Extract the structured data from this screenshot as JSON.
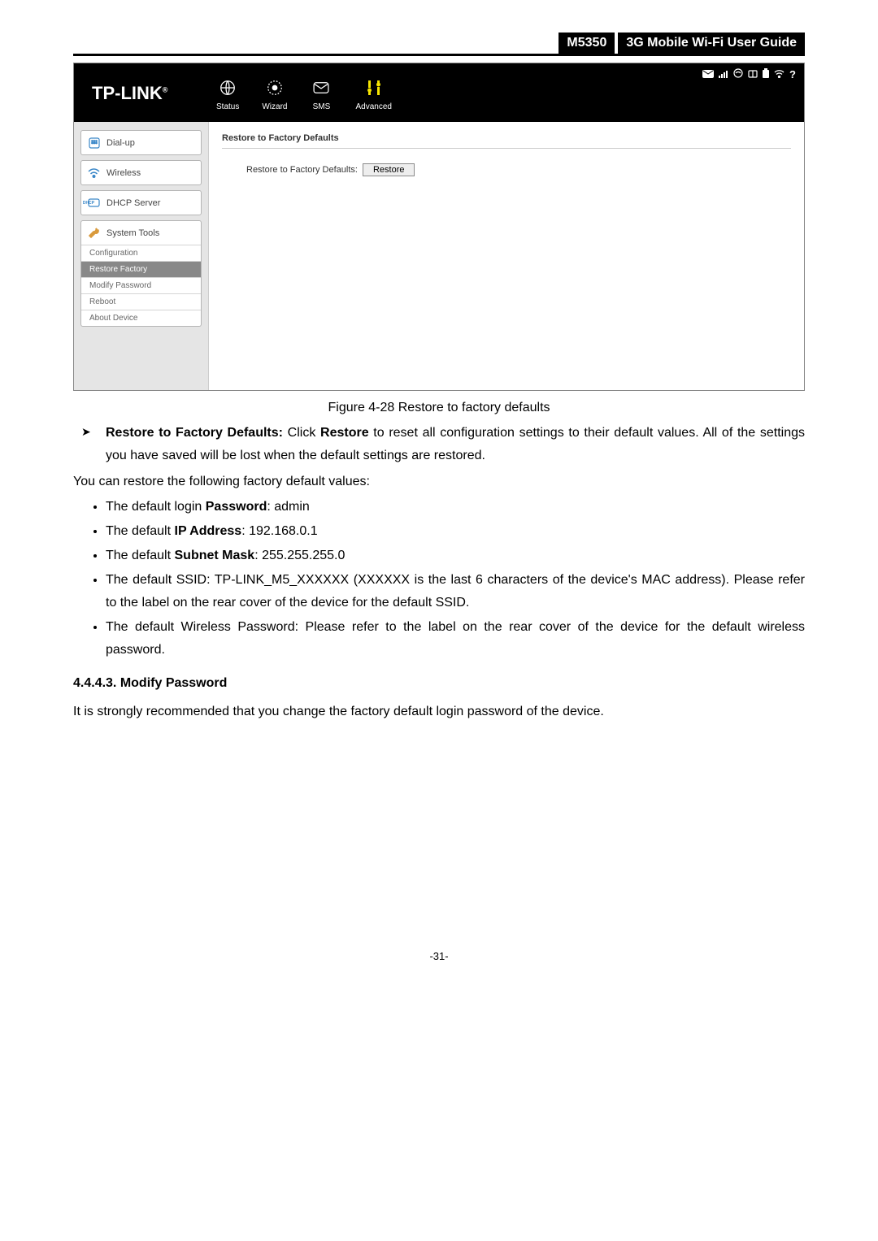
{
  "header": {
    "model": "M5350",
    "title": "3G Mobile Wi-Fi User Guide"
  },
  "app": {
    "logo": "TP-LINK",
    "topnav": {
      "status": "Status",
      "wizard": "Wizard",
      "sms": "SMS",
      "advanced": "Advanced"
    },
    "sidebar": {
      "dialup": "Dial-up",
      "wireless": "Wireless",
      "dhcp": "DHCP Server",
      "system": "System Tools",
      "sub": {
        "config": "Configuration",
        "restore": "Restore Factory",
        "modify": "Modify Password",
        "reboot": "Reboot",
        "about": "About Device"
      }
    },
    "content": {
      "title": "Restore to Factory Defaults",
      "row_label": "Restore to Factory Defaults:",
      "btn": "Restore"
    }
  },
  "doc": {
    "caption": "Figure 4-28 Restore to factory defaults",
    "restore_bold": "Restore to Factory Defaults:",
    "restore_mid1": " Click ",
    "restore_bold2": "Restore",
    "restore_rest": " to reset all configuration settings to their default values. All of the settings you have saved will be lost when the default settings are restored.",
    "p2": "You can restore the following factory default values:",
    "b1a": "The default login ",
    "b1b": "Password",
    "b1c": ": admin",
    "b2a": "The default ",
    "b2b": "IP Address",
    "b2c": ": 192.168.0.1",
    "b3a": "The default ",
    "b3b": "Subnet Mask",
    "b3c": ": 255.255.255.0",
    "b4": "The default SSID: TP-LINK_M5_XXXXXX (XXXXXX is the last 6 characters of the device's MAC address). Please refer to the label on the rear cover of the device for the default SSID.",
    "b5": "The default Wireless Password: Please refer to the label on the rear cover of the device for the default wireless password.",
    "sechead": "4.4.4.3.  Modify Password",
    "secpara": "It is strongly recommended that you change the factory default login password of the device.",
    "pagenum": "-31-"
  }
}
